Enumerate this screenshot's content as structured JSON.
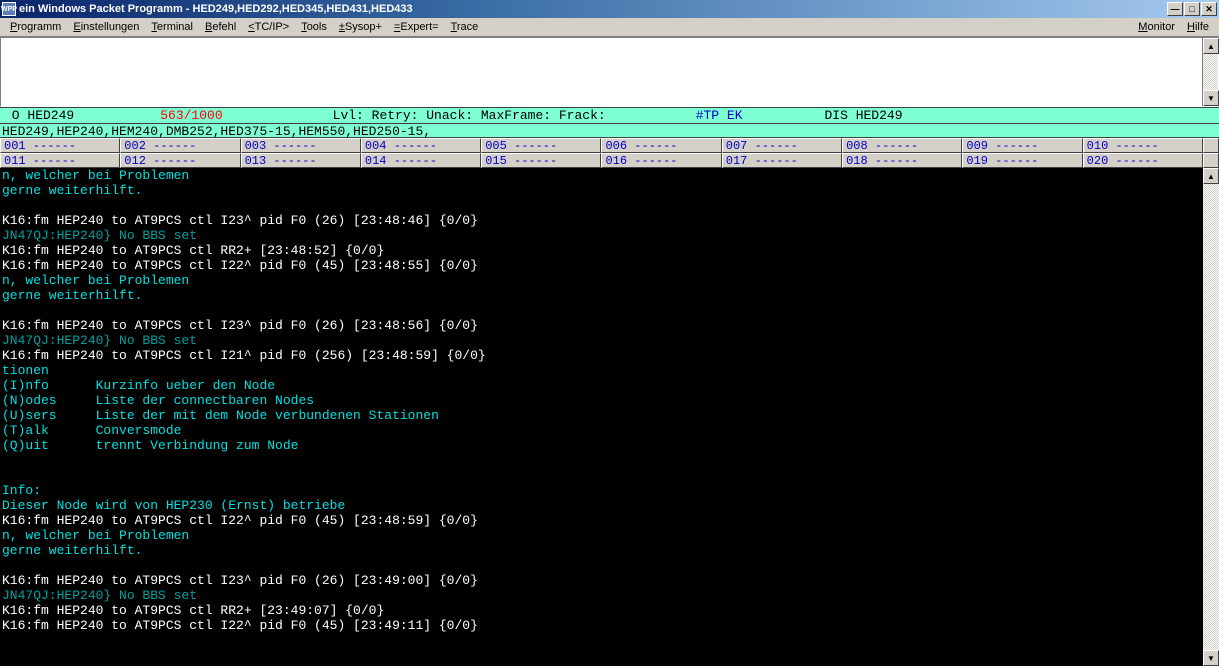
{
  "window": {
    "icon_text": "WPP",
    "title": "ein Windows Packet Programm - HED249,HED292,HED345,HED431,HED433"
  },
  "menu": {
    "left": [
      {
        "key": "P",
        "label": "rogramm"
      },
      {
        "key": "E",
        "label": "instellungen"
      },
      {
        "key": "T",
        "label": "erminal"
      },
      {
        "key": "B",
        "label": "efehl"
      },
      {
        "key": "<",
        "label": "TC/IP>"
      },
      {
        "key": "T",
        "label": "ools",
        "pre": ""
      },
      {
        "key": "±",
        "label": "Sysop+"
      },
      {
        "key": "=",
        "label": "Expert="
      },
      {
        "key": "T",
        "label": "race",
        "pre": "  "
      }
    ],
    "right": [
      {
        "key": "M",
        "label": "onitor"
      },
      {
        "key": "H",
        "label": "ilfe"
      }
    ]
  },
  "status": {
    "left": " O HED249",
    "counter": "563/1000",
    "mid": "Lvl: Retry: Unack: MaxFrame: Frack:",
    "tag": "#TP EK",
    "right": "DIS HED249"
  },
  "path": "HED249,HEP240,HEM240,DMB252,HED375-15,HEM550,HED250-15,",
  "channels_row1": [
    "001 ------",
    "002 ------",
    "003 ------",
    "004 ------",
    "005 ------",
    "006 ------",
    "007 ------",
    "008 ------",
    "009 ------",
    "010 ------"
  ],
  "channels_row2": [
    "011 ------",
    "012 ------",
    "013 ------",
    "014 ------",
    "015 ------",
    "016 ------",
    "017 ------",
    "018 ------",
    "019 ------",
    "020 ------"
  ],
  "terminal_lines": [
    {
      "c": "cyan",
      "t": "n, welcher bei Problemen"
    },
    {
      "c": "cyan",
      "t": "gerne weiterhilft."
    },
    {
      "c": "white",
      "t": ""
    },
    {
      "c": "white",
      "t": "K16:fm HEP240 to AT9PCS ctl I23^ pid F0 (26) [23:48:46] {0/0}"
    },
    {
      "c": "teal",
      "t": "JN47QJ:HEP240} No BBS set"
    },
    {
      "c": "white",
      "t": "K16:fm HEP240 to AT9PCS ctl RR2+ [23:48:52] {0/0}"
    },
    {
      "c": "white",
      "t": "K16:fm HEP240 to AT9PCS ctl I22^ pid F0 (45) [23:48:55] {0/0}"
    },
    {
      "c": "cyan",
      "t": "n, welcher bei Problemen"
    },
    {
      "c": "cyan",
      "t": "gerne weiterhilft."
    },
    {
      "c": "white",
      "t": ""
    },
    {
      "c": "white",
      "t": "K16:fm HEP240 to AT9PCS ctl I23^ pid F0 (26) [23:48:56] {0/0}"
    },
    {
      "c": "teal",
      "t": "JN47QJ:HEP240} No BBS set"
    },
    {
      "c": "white",
      "t": "K16:fm HEP240 to AT9PCS ctl I21^ pid F0 (256) [23:48:59] {0/0}"
    },
    {
      "c": "cyan",
      "t": "tionen"
    },
    {
      "c": "cyan",
      "t": "(I)nfo      Kurzinfo ueber den Node"
    },
    {
      "c": "cyan",
      "t": "(N)odes     Liste der connectbaren Nodes"
    },
    {
      "c": "cyan",
      "t": "(U)sers     Liste der mit dem Node verbundenen Stationen"
    },
    {
      "c": "cyan",
      "t": "(T)alk      Conversmode"
    },
    {
      "c": "cyan",
      "t": "(Q)uit      trennt Verbindung zum Node"
    },
    {
      "c": "cyan",
      "t": ""
    },
    {
      "c": "cyan",
      "t": ""
    },
    {
      "c": "cyan",
      "t": "Info:"
    },
    {
      "c": "cyan",
      "t": "Dieser Node wird von HEP230 (Ernst) betriebe"
    },
    {
      "c": "white",
      "t": "K16:fm HEP240 to AT9PCS ctl I22^ pid F0 (45) [23:48:59] {0/0}"
    },
    {
      "c": "cyan",
      "t": "n, welcher bei Problemen"
    },
    {
      "c": "cyan",
      "t": "gerne weiterhilft."
    },
    {
      "c": "white",
      "t": ""
    },
    {
      "c": "white",
      "t": "K16:fm HEP240 to AT9PCS ctl I23^ pid F0 (26) [23:49:00] {0/0}"
    },
    {
      "c": "teal",
      "t": "JN47QJ:HEP240} No BBS set"
    },
    {
      "c": "white",
      "t": "K16:fm HEP240 to AT9PCS ctl RR2+ [23:49:07] {0/0}"
    },
    {
      "c": "white",
      "t": "K16:fm HEP240 to AT9PCS ctl I22^ pid F0 (45) [23:49:11] {0/0}"
    }
  ]
}
